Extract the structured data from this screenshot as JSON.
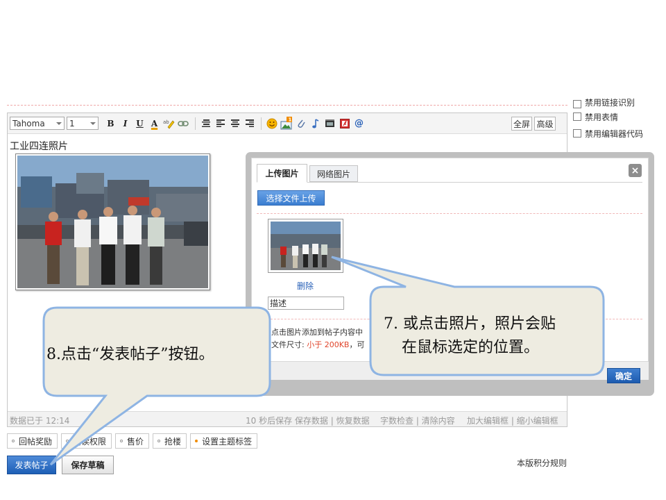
{
  "options": {
    "items": [
      {
        "label": "禁用链接识别",
        "checked": false
      },
      {
        "label": "禁用表情",
        "checked": false
      },
      {
        "label": "禁用编辑器代码",
        "checked": false
      }
    ]
  },
  "editor": {
    "font_select": "Tahoma",
    "size_select": "1",
    "btn_bold": "B",
    "btn_italic": "I",
    "btn_underline": "U",
    "btn_fontcolor": "A",
    "btn_fullscreen": "全屏",
    "btn_advanced": "高级",
    "content_title": "工业四连照片",
    "status": {
      "saved": "数据已于 12:14",
      "autosave": "10 秒后保存 保存数据 | 恢复数据",
      "count_clear": "字数检查 | 清除内容",
      "resize": "加大编辑框 | 缩小编辑框"
    }
  },
  "extras": [
    {
      "label": "回帖奖励",
      "accent": false
    },
    {
      "label": "阅读权限",
      "accent": false
    },
    {
      "label": "售价",
      "accent": false
    },
    {
      "label": "抢楼",
      "accent": false
    },
    {
      "label": "设置主题标签",
      "accent": true
    }
  ],
  "actions": {
    "post_label": "发表帖子",
    "draft_label": "保存草稿",
    "rules_link": "本版积分规则"
  },
  "dialog": {
    "tab_upload": "上传图片",
    "tab_network": "网络图片",
    "close_icon": "×",
    "choose_button": "选择文件上传",
    "delete_link": "删除",
    "description_value": "描述",
    "hint_line1": "点击图片添加到帖子内容中",
    "hint_size_prefix": "文件尺寸: ",
    "hint_size_value": "小于 200KB",
    "hint_size_suffix": "，可",
    "ok_button": "确定"
  },
  "callouts": {
    "step8": "8.点击“发表帖子”按钮。",
    "step7_line1": "7. 或点击照片，照片会贴",
    "step7_line2": "在鼠标选定的位置。"
  },
  "colors": {
    "accent_blue": "#2a62b8",
    "callout_fill": "#eeece1",
    "callout_stroke": "#8eb4e3",
    "size_limit_red": "#e0442a"
  }
}
